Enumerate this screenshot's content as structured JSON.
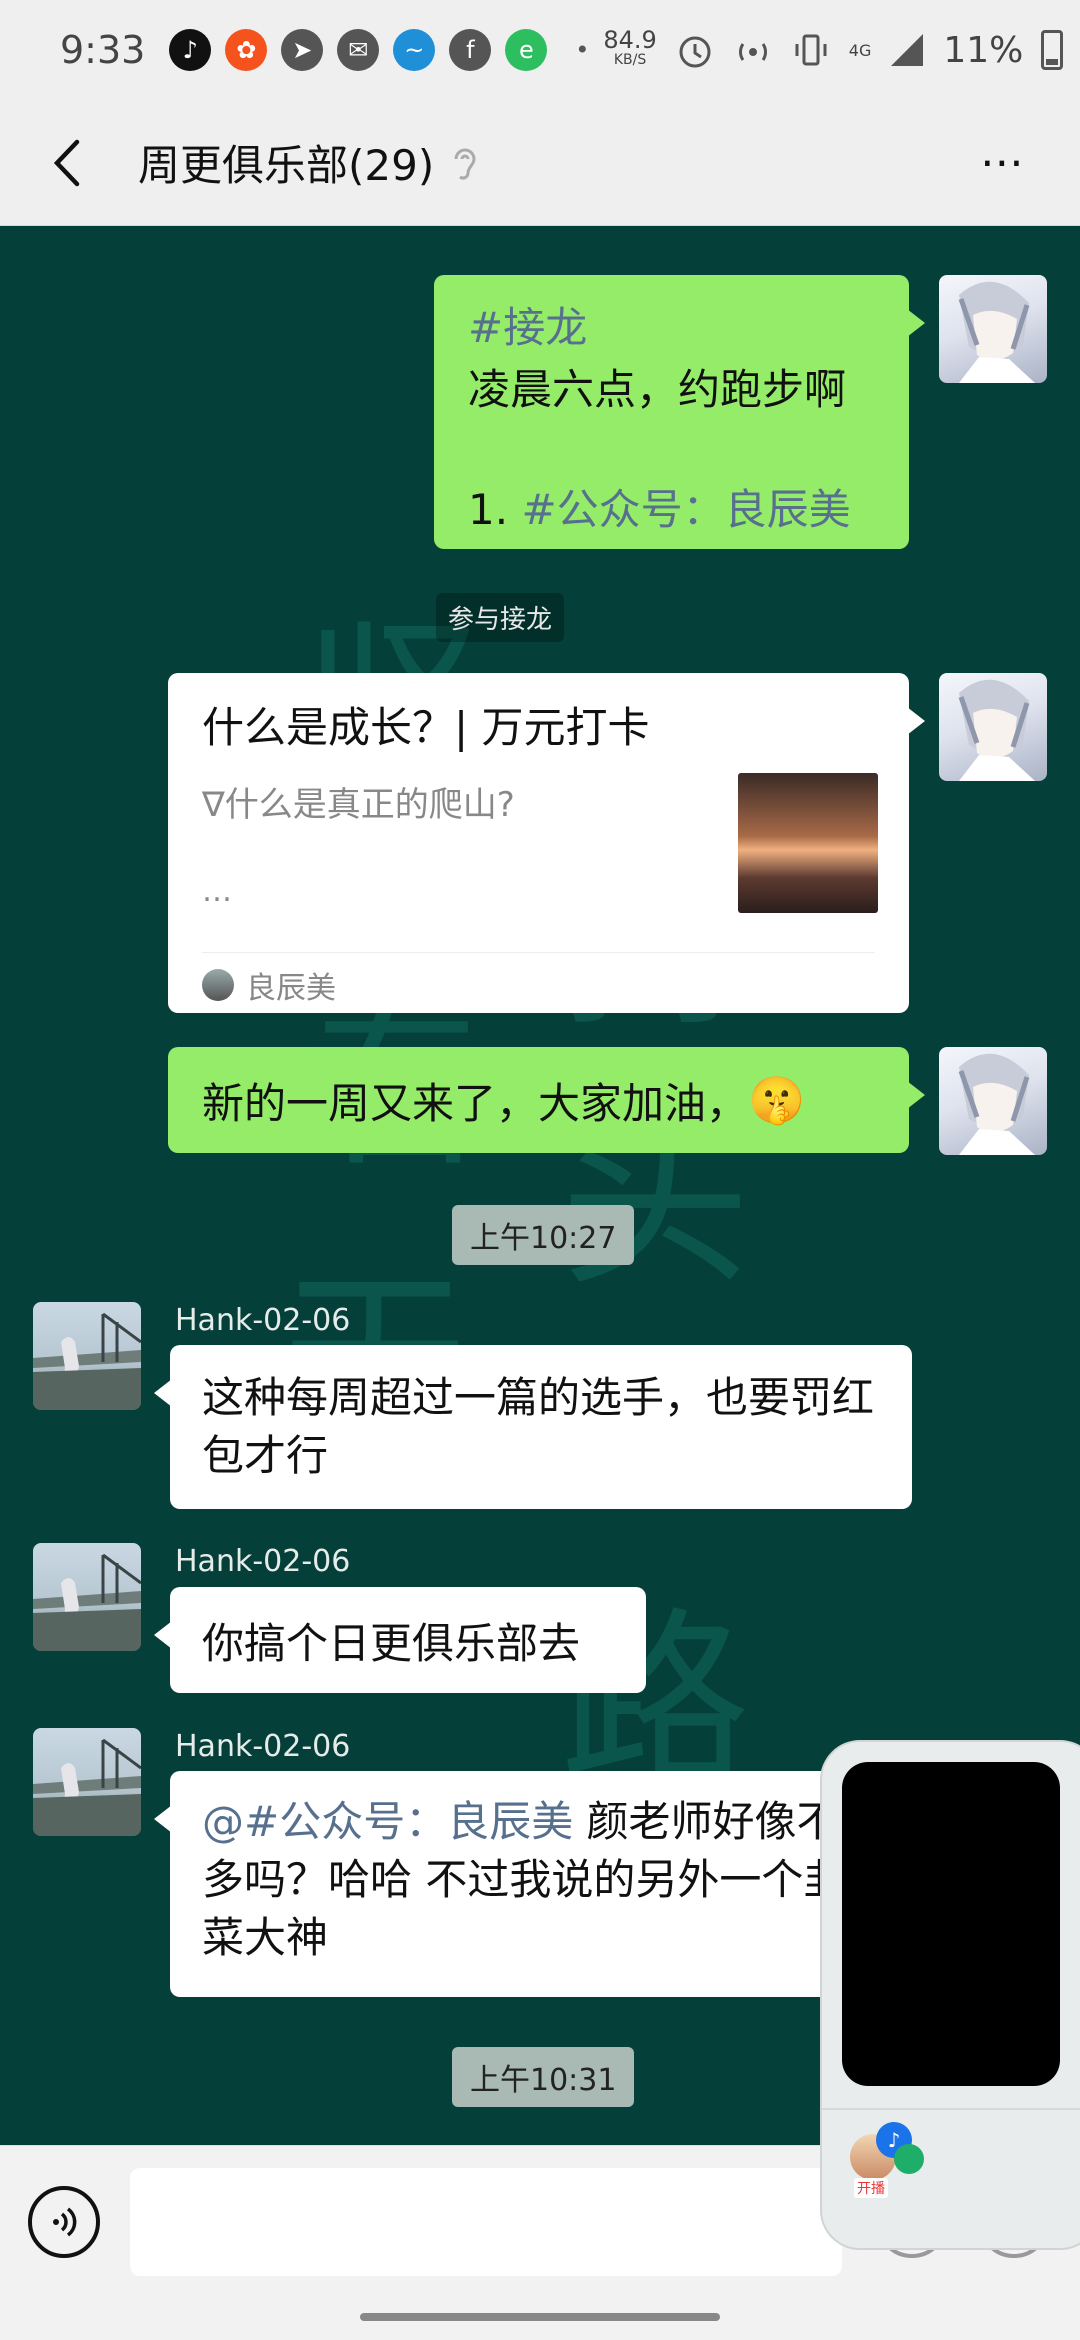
{
  "status_bar": {
    "time": "9:33",
    "speed_value": "84.9",
    "speed_unit": "KB/S",
    "network": "4G",
    "battery": "11%",
    "icons": [
      "tiktok-icon",
      "app-icon",
      "send-icon",
      "mail-icon",
      "wave-icon",
      "facebook-icon",
      "evernote-icon",
      "dot-icon",
      "alarm-icon",
      "hotspot-icon",
      "vibrate-icon",
      "signal-icon",
      "battery-icon"
    ]
  },
  "header": {
    "title": "周更俱乐部(29)",
    "more": "⋯"
  },
  "watermark_chars": [
    "坚",
    "持",
    "看",
    "头",
    "天",
    "路"
  ],
  "messages": {
    "m1": {
      "tag": "#接龙",
      "line1": "凌晨六点，约跑步啊",
      "item_prefix": "1. ",
      "item_link": "#公众号：良辰美"
    },
    "join_tag": "参与接龙",
    "card": {
      "title": "什么是成长？| 万元打卡",
      "desc": "∇什么是真正的爬山?",
      "ellipsis": "…",
      "source": "良辰美"
    },
    "m3": {
      "text": "新的一周又来了，大家加油，",
      "emoji": "🤫"
    },
    "time1": "上午10:27",
    "m4": {
      "sender": "Hank-02-06",
      "text": "这种每周超过一篇的选手，也要罚红包才行"
    },
    "m5": {
      "sender": "Hank-02-06",
      "text": "你搞个日更俱乐部去"
    },
    "m6": {
      "sender": "Hank-02-06",
      "mention": "@#公众号：良辰美",
      "text": " 颜老师好像不多吗？哈哈  不过我说的另外一个韭菜大神"
    },
    "time2": "上午10:31"
  },
  "float_window": {
    "badge_text": "开播"
  },
  "input": {
    "placeholder": ""
  }
}
